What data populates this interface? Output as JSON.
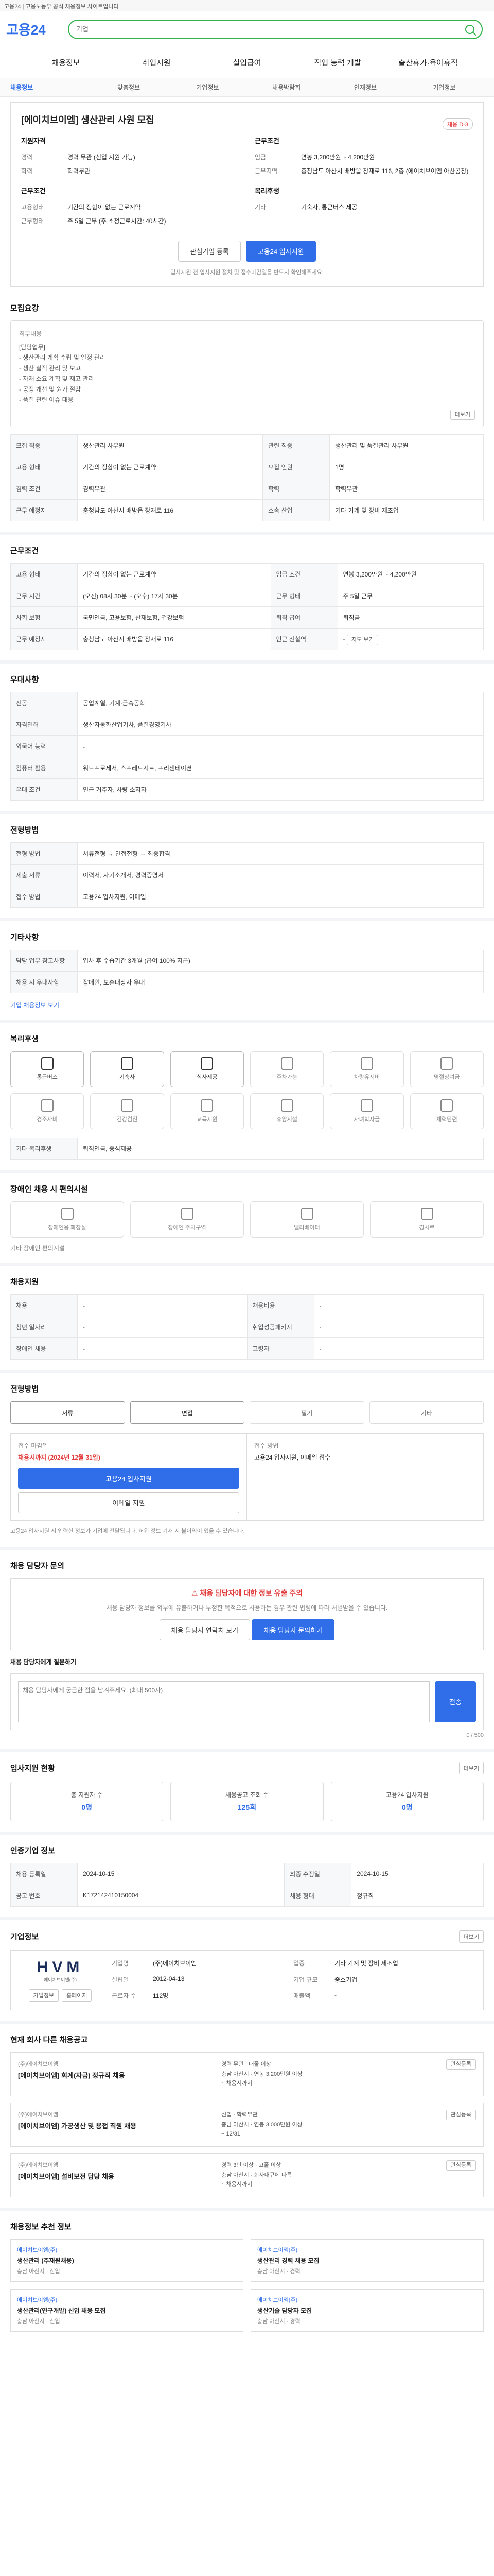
{
  "topbar": {
    "text": "고용24 | 고용노동부 공식 채용정보 사이트입니다"
  },
  "header": {
    "logo_prefix": "고용",
    "logo_suffix": "24",
    "search_placeholder": "기업"
  },
  "gnb": [
    "채용정보",
    "취업지원",
    "실업급여",
    "직업 능력 개발",
    "출산휴가·육아휴직"
  ],
  "subnav": [
    "채용정보",
    "맞춤정보",
    "기업정보",
    "채용박람회",
    "인재정보",
    "기업정보"
  ],
  "job": {
    "title": "[에이치브이엠] 생산관리 사원 모집",
    "badge": "채용 D-3",
    "left": {
      "h1": "지원자격",
      "rows": [
        [
          "경력",
          "경력 무관 (신입 지원 가능)"
        ],
        [
          "학력",
          "학력무관"
        ]
      ],
      "h2": "근무조건",
      "rows2": [
        [
          "고용형태",
          "기간의 정함이 없는 근로계약"
        ],
        [
          "근무형태",
          "주 5일 근무 (주 소정근로시간: 40시간)"
        ]
      ]
    },
    "right": {
      "h1": "근무조건",
      "rows": [
        [
          "임금",
          "연봉 3,200만원 ~ 4,200만원"
        ],
        [
          "근무지역",
          "충청남도 아산시 배방읍 장재로 116, 2층 (에이치브이엠 아산공장)"
        ]
      ],
      "h2": "복리후생",
      "rows2": [
        [
          "기타",
          "기숙사, 통근버스 제공"
        ]
      ]
    },
    "scrap_button": "관심기업 등록",
    "apply_button": "고용24 입사지원",
    "note": "입사지원 전 입사지원 절차 및 접수마감일을 반드시 확인해주세요."
  },
  "recruit": {
    "title": "모집요강",
    "duty_label": "직무내용",
    "duty": "[담당업무]\n - 생산관리 계획 수립 및 일정 관리\n - 생산 실적 관리 및 보고\n - 자재 소요 계획 및 재고 관리\n - 공정 개선 및 원가 절감\n - 품질 관련 이슈 대응",
    "more": "더보기",
    "rows": [
      [
        "모집 직종",
        "생산관리 사무원",
        "관련 직종",
        "생산관리 및 품질관리 사무원"
      ],
      [
        "고용 형태",
        "기간의 정함이 없는 근로계약",
        "모집 인원",
        "1명"
      ],
      [
        "경력 조건",
        "경력무관",
        "학력",
        "학력무관"
      ],
      [
        "근무 예정지",
        "충청남도 아산시 배방읍 장재로 116",
        "소속 산업",
        "기타 기계 및 장비 제조업"
      ]
    ]
  },
  "conditions": {
    "title": "근무조건",
    "rows": [
      [
        "고용 형태",
        "기간의 정함이 없는 근로계약",
        "임금 조건",
        "연봉 3,200만원 ~ 4,200만원"
      ],
      [
        "근무 시간",
        "(오전) 08시 30분 ~ (오후) 17시 30분",
        "근무 형태",
        "주 5일 근무"
      ],
      [
        "사회 보험",
        "국민연금, 고용보험, 산재보험, 건강보험",
        "퇴직 급여",
        "퇴직금"
      ],
      [
        "근무 예정지",
        "충청남도 아산시 배방읍 장재로 116",
        "인근 전철역",
        "-"
      ]
    ],
    "map_button": "지도 보기"
  },
  "qualifications": {
    "title": "우대사항",
    "rows": [
      [
        "전공",
        "공업계열, 기계·금속공학"
      ],
      [
        "자격면허",
        "생산자동화산업기사, 품질경영기사"
      ],
      [
        "외국어 능력",
        "-"
      ],
      [
        "컴퓨터 활용",
        "워드프로세서, 스프레드시트, 프리젠테이션"
      ],
      [
        "우대 조건",
        "인근 거주자, 차량 소지자"
      ]
    ]
  },
  "process": {
    "title": "전형방법",
    "rows": [
      [
        "전형 방법",
        "서류전형 → 면접전형 → 최종합격"
      ],
      [
        "제출 서류",
        "이력서, 자기소개서, 경력증명서"
      ],
      [
        "접수 방법",
        "고용24 입사지원, 이메일"
      ]
    ]
  },
  "etc": {
    "title": "기타사항",
    "rows": [
      [
        "담당 업무 참고사항",
        "입사 후 수습기간 3개월 (급여 100% 지급)"
      ],
      [
        "채용 시 우대사항",
        "장애인, 보훈대상자 우대"
      ]
    ],
    "link": "기업 채용정보 보기"
  },
  "welfare": {
    "title": "복리후생",
    "items": [
      {
        "label": "통근버스",
        "on": true
      },
      {
        "label": "기숙사",
        "on": true
      },
      {
        "label": "식사제공",
        "on": true
      },
      {
        "label": "주차가능",
        "on": false
      },
      {
        "label": "차량유지비",
        "on": false
      },
      {
        "label": "명절상여금",
        "on": false
      },
      {
        "label": "경조사비",
        "on": false
      },
      {
        "label": "건강검진",
        "on": false
      },
      {
        "label": "교육지원",
        "on": false
      },
      {
        "label": "휴양시설",
        "on": false
      },
      {
        "label": "자녀학자금",
        "on": false
      },
      {
        "label": "체력단련",
        "on": false
      }
    ],
    "etc_label": "기타 복리후생",
    "etc_value": "퇴직연금, 중식제공"
  },
  "disability": {
    "title": "장애인 채용 시 편의시설",
    "items": [
      "장애인용 화장실",
      "장애인 주차구역",
      "엘리베이터",
      "경사로"
    ],
    "etc": "기타 장애인 편의시설"
  },
  "support": {
    "title": "채용지원",
    "rows": [
      [
        "채용",
        "-",
        "채용비용",
        "-"
      ],
      [
        "청년 일자리",
        "-",
        "취업성공패키지",
        "-"
      ],
      [
        "장애인 채용",
        "-",
        "고령자",
        "-"
      ]
    ]
  },
  "steps": {
    "title": "전형방법",
    "items": [
      {
        "label": "서류",
        "on": true
      },
      {
        "label": "면접",
        "on": true
      },
      {
        "label": "필기",
        "on": false
      },
      {
        "label": "기타",
        "on": false
      }
    ]
  },
  "apply": {
    "left_title": "접수 마감일",
    "left_value": "채용시까지 (2024년 12월 31일)",
    "left_button": "고용24 입사지원",
    "left_sub_button": "이메일 지원",
    "right_title": "접수 방법",
    "right_value": "고용24 입사지원, 이메일 접수",
    "notice": "고용24 입사지원 시 입력한 정보가 기업에 전달됩니다. 허위 정보 기재 시 불이익이 있을 수 있습니다."
  },
  "qa": {
    "title": "채용 담당자 문의",
    "warn_title": "채용 담당자에 대한 정보 유출 주의",
    "warn_text": "채용 담당자 정보를 외부에 유출하거나 부정한 목적으로 사용하는 경우 관련 법령에 따라 처벌받을 수 있습니다.",
    "contact_button": "채용 담당자 연락처 보기",
    "question_button": "채용 담당자 문의하기",
    "label": "채용 담당자에게 질문하기",
    "placeholder": "채용 담당자에게 궁금한 점을 남겨주세요. (최대 500자)",
    "submit": "전송",
    "counter": "0 / 500"
  },
  "stats": {
    "title": "입사지원 현황",
    "items": [
      {
        "label": "총 지원자 수",
        "value": "0명"
      },
      {
        "label": "채용공고 조회 수",
        "value": "125회"
      },
      {
        "label": "고용24 입사지원",
        "value": "0명"
      }
    ],
    "more": "더보기"
  },
  "history": {
    "title": "인증기업 정보",
    "rows": [
      [
        "채용 등록일",
        "2024-10-15",
        "최종 수정일",
        "2024-10-15"
      ],
      [
        "공고 번호",
        "K172142410150004",
        "채용 형태",
        "정규직"
      ]
    ]
  },
  "company": {
    "title": "기업정보",
    "name": "HVM",
    "sub": "에이치브이엠(주)",
    "rows": [
      [
        "기업명",
        "(주)에이치브이엠"
      ],
      [
        "업종",
        "기타 기계 및 장비 제조업"
      ],
      [
        "설립일",
        "2012-04-13"
      ],
      [
        "기업 규모",
        "중소기업"
      ],
      [
        "근로자 수",
        "112명"
      ],
      [
        "매출액",
        "-"
      ]
    ],
    "button1": "기업정보",
    "button2": "홈페이지",
    "more": "더보기"
  },
  "same_jobs": {
    "title": "현재 회사 다른 채용공고",
    "items": [
      {
        "co": "(주)에이치브이엠",
        "ttl": "[에이치브이엠] 회계(자금) 정규직 채용",
        "meta1": "경력 무관 · 대졸 이상",
        "meta2": "충남 아산시 · 연봉 3,200만원 이상",
        "date": "~ 채용시까지"
      },
      {
        "co": "(주)에이치브이엠",
        "ttl": "[에이치브이엠] 가공생산 및 용접 직원 채용",
        "meta1": "신입 · 학력무관",
        "meta2": "충남 아산시 · 연봉 3,000만원 이상",
        "date": "~ 12/31"
      },
      {
        "co": "(주)에이치브이엠",
        "ttl": "[에이치브이엠] 설비보전 담당 채용",
        "meta1": "경력 3년 이상 · 고졸 이상",
        "meta2": "충남 아산시 · 회사내규에 따름",
        "date": "~ 채용시까지"
      }
    ],
    "scrap": "관심등록"
  },
  "recommend": {
    "title": "채용정보 추천 정보",
    "items": [
      {
        "co": "에이치브이엠(주)",
        "ttl": "생산관리 (주재원채용)",
        "sub": "충남 아산시 · 신입"
      },
      {
        "co": "에이치브이엠(주)",
        "ttl": "생산관리 경력 채용 모집",
        "sub": "충남 아산시 · 경력"
      },
      {
        "co": "에이치브이엠(주)",
        "ttl": "생산관리(연구개발) 신입 채용 모집",
        "sub": "충남 아산시 · 신입"
      },
      {
        "co": "에이치브이엠(주)",
        "ttl": "생산기술 담당자 모집",
        "sub": "충남 아산시 · 경력"
      }
    ]
  },
  "colors": {
    "accent": "#2f6ee8",
    "search_border": "#2fb34a",
    "danger": "#e23b3b"
  }
}
